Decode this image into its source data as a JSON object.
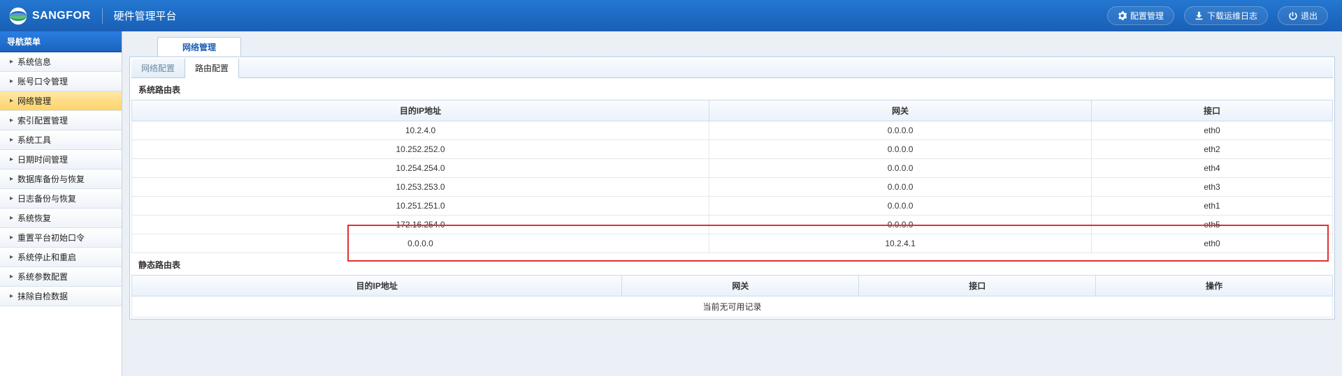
{
  "header": {
    "brand": "SANGFOR",
    "title": "硬件管理平台",
    "config_label": "配置管理",
    "download_label": "下载运维日志",
    "logout_label": "退出"
  },
  "sidebar": {
    "title": "导航菜单",
    "items": [
      {
        "label": "系统信息",
        "active": false
      },
      {
        "label": "账号口令管理",
        "active": false
      },
      {
        "label": "网络管理",
        "active": true
      },
      {
        "label": "索引配置管理",
        "active": false
      },
      {
        "label": "系统工具",
        "active": false
      },
      {
        "label": "日期时间管理",
        "active": false
      },
      {
        "label": "数据库备份与恢复",
        "active": false
      },
      {
        "label": "日志备份与恢复",
        "active": false
      },
      {
        "label": "系统恢复",
        "active": false
      },
      {
        "label": "重置平台初始口令",
        "active": false
      },
      {
        "label": "系统停止和重启",
        "active": false
      },
      {
        "label": "系统参数配置",
        "active": false
      },
      {
        "label": "抹除自检数据",
        "active": false
      }
    ]
  },
  "main": {
    "top_tab": "网络管理",
    "sub_tabs": [
      {
        "label": "网络配置",
        "active": false
      },
      {
        "label": "路由配置",
        "active": true
      }
    ],
    "section1_label": "系统路由表",
    "table1": {
      "headers": [
        "目的IP地址",
        "网关",
        "接口"
      ],
      "rows": [
        {
          "dest": "10.2.4.0",
          "gw": "0.0.0.0",
          "if": "eth0",
          "hl": false
        },
        {
          "dest": "10.252.252.0",
          "gw": "0.0.0.0",
          "if": "eth2",
          "hl": false
        },
        {
          "dest": "10.254.254.0",
          "gw": "0.0.0.0",
          "if": "eth4",
          "hl": false
        },
        {
          "dest": "10.253.253.0",
          "gw": "0.0.0.0",
          "if": "eth3",
          "hl": false
        },
        {
          "dest": "10.251.251.0",
          "gw": "0.0.0.0",
          "if": "eth1",
          "hl": false
        },
        {
          "dest": "172.16.254.0",
          "gw": "0.0.0.0",
          "if": "eth5",
          "hl": false
        },
        {
          "dest": "0.0.0.0",
          "gw": "10.2.4.1",
          "if": "eth0",
          "hl": true
        }
      ]
    },
    "section2_label": "静态路由表",
    "table2": {
      "headers": [
        "目的IP地址",
        "网关",
        "接口",
        "操作"
      ],
      "empty_text": "当前无可用记录"
    }
  }
}
